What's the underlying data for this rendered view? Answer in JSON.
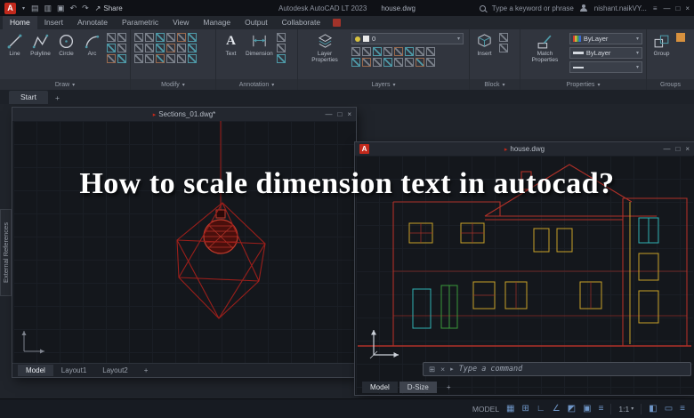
{
  "ui": {
    "caret": "▾",
    "add": "+",
    "marker": "▸",
    "minimize": "—",
    "maximize": "□",
    "close": "×",
    "menu": "≡"
  },
  "titlebar": {
    "logo_letter": "A",
    "qat_icons": [
      "▤",
      "▥",
      "▣",
      "↶",
      "↷"
    ],
    "share_icon": "↗",
    "share_label": "Share",
    "app_title": "Autodesk AutoCAD LT 2023",
    "doc_title": "house.dwg",
    "search_placeholder": "Type a keyword or phrase",
    "user_name": "nishant.naikVY..."
  },
  "ribbon_tabs": {
    "items": [
      "Home",
      "Insert",
      "Annotate",
      "Parametric",
      "View",
      "Manage",
      "Output",
      "Collaborate"
    ]
  },
  "ribbon": {
    "draw": {
      "label": "Draw",
      "line": "Line",
      "polyline": "Polyline",
      "circle": "Circle",
      "arc": "Arc"
    },
    "modify": {
      "label": "Modify"
    },
    "annotation": {
      "label": "Annotation",
      "text": "Text",
      "text_icon_glyph": "A",
      "dimension": "Dimension"
    },
    "layers": {
      "label": "Layers",
      "layer_properties": "Layer\nProperties",
      "current_layer": "0"
    },
    "block": {
      "label": "Block",
      "insert": "Insert"
    },
    "properties": {
      "label": "Properties",
      "match_properties": "Match\nProperties",
      "color": "ByLayer",
      "lineweight": "ByLayer"
    },
    "groups": {
      "label": "Groups",
      "group": "Group"
    }
  },
  "file_tabs": {
    "start": "Start"
  },
  "win1": {
    "title": "Sections_01.dwg*",
    "tabs": {
      "model": "Model",
      "layout1": "Layout1",
      "layout2": "Layout2"
    }
  },
  "win2": {
    "logo_letter": "A",
    "title": "house.dwg",
    "command_prompt": "Type a command",
    "tabs": {
      "model": "Model",
      "dsize": "D-Size"
    }
  },
  "overlay": {
    "title": "How to scale dimension text in autocad?"
  },
  "xref_panel": {
    "label": "External References"
  },
  "statusbar": {
    "model_label": "MODEL",
    "icons": [
      "▦",
      "⊞",
      "∟",
      "∠",
      "◩",
      "▣",
      "≡"
    ],
    "scale": "1:1",
    "right_icons": [
      "◧",
      "▭",
      "≡"
    ]
  },
  "colors": {
    "accent_red": "#c2291c",
    "drawing_red": "#a32622",
    "window_yellow": "#c9a227",
    "door_green": "#3a9a3a",
    "frame_cyan": "#2fb3b3"
  }
}
